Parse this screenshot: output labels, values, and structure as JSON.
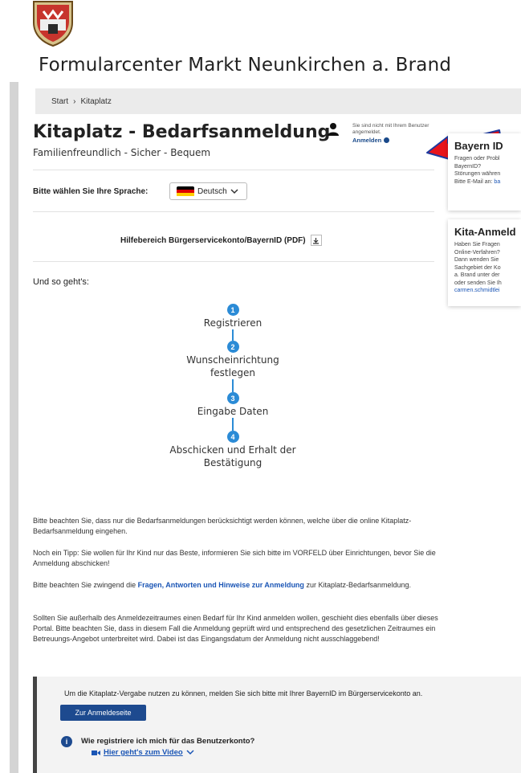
{
  "site": {
    "title": "Formularcenter Markt Neunkirchen a. Brand"
  },
  "breadcrumb": {
    "home": "Start",
    "separator": "›",
    "current": "Kitaplatz"
  },
  "page": {
    "title": "Kitaplatz - Bedarfsanmeldung",
    "subtitle": "Familienfreundlich - Sicher - Bequem"
  },
  "login": {
    "note": "Sie sind nicht mit Ihrem Benutzer angemeldet.",
    "link": "Anmelden"
  },
  "language": {
    "label": "Bitte wählen Sie Ihre Sprache:",
    "selected": "Deutsch"
  },
  "help": {
    "label": "Hilfebereich Bürgerservicekonto/BayernID (PDF)"
  },
  "how": {
    "label": "Und so geht's:"
  },
  "steps": [
    {
      "num": "1",
      "line1": "Registrieren",
      "line2": ""
    },
    {
      "num": "2",
      "line1": "Wunscheinrichtung",
      "line2": "festlegen"
    },
    {
      "num": "3",
      "line1": "Eingabe Daten",
      "line2": ""
    },
    {
      "num": "4",
      "line1": "Abschicken und Erhalt der",
      "line2": "Bestätigung"
    }
  ],
  "paragraphs": {
    "p1": "Bitte beachten Sie, dass nur die Bedarfsanmeldungen berücksichtigt werden können, welche über die online Kitaplatz-Bedarfsanmeldung eingehen.",
    "p2": "Noch ein Tipp: Sie wollen für Ihr Kind nur das Beste, informieren Sie sich bitte im VORFELD über Einrichtungen, bevor Sie die Anmeldung abschicken!",
    "p3_before": "Bitte beachten Sie zwingend die ",
    "p3_link": "Fragen, Antworten und Hinweise zur Anmeldung",
    "p3_after": " zur Kitaplatz-Bedarfsanmeldung.",
    "p4": "Sollten Sie außerhalb des Anmeldezeitraumes einen Bedarf für Ihr Kind anmelden wollen, geschieht dies ebenfalls über dieses Portal. Bitte beachten Sie, dass in diesem Fall die Anmeldung geprüft wird und entsprechend des gesetzlichen Zeitraumes ein Betreuungs-Angebot unterbreitet wird. Dabei ist das Eingangsdatum der Anmeldung nicht ausschlaggebend!"
  },
  "notice": {
    "text": "Um die Kitaplatz-Vergabe nutzen zu können, melden Sie sich bitte mit Ihrer BayernID im Bürgerservicekonto an.",
    "button": "Zur Anmeldeseite",
    "faq_question": "Wie registriere ich mich für das Benutzerkonto?",
    "faq_video": "Hier geht's zum Video"
  },
  "sidebar": {
    "bayern": {
      "title": "Bayern ID",
      "lines": [
        "Fragen oder Probl",
        "BayernID?",
        "Störungen währen"
      ],
      "email_prefix": "Bitte E-Mail an: ",
      "email_link": "ba"
    },
    "kita": {
      "title": "Kita-Anmeld",
      "lines": [
        "Haben Sie Fragen",
        "Online-Verfahren?",
        "Dann wenden Sie",
        "Sachgebiet der Ko",
        "a. Brand unter der",
        "oder senden Sie Ih"
      ],
      "email_link": "carmen.schmidtlei"
    }
  },
  "colors": {
    "step_blue": "#2b8bd6",
    "button_blue": "#1d4a8f",
    "link_blue": "#1a55b5",
    "arrow_red": "#e8141b",
    "arrow_outline": "#1d3aa0"
  },
  "icons": {
    "user": "user-icon",
    "info": "info-icon",
    "download": "download-icon",
    "video": "video-icon",
    "chevron": "chevron-down-icon"
  }
}
